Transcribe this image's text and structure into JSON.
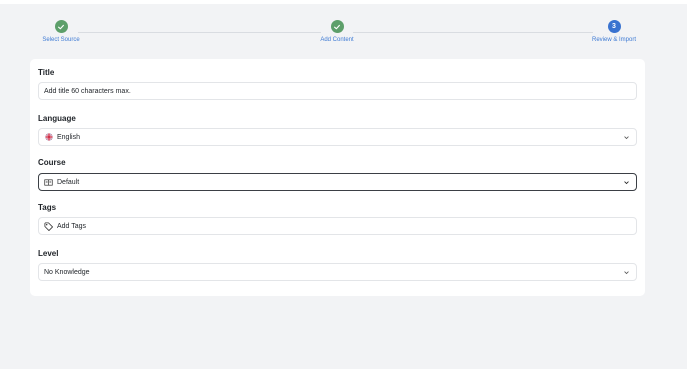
{
  "stepper": {
    "steps": [
      {
        "label": "Select Source",
        "status": "done",
        "number": ""
      },
      {
        "label": "Add Content",
        "status": "done",
        "number": ""
      },
      {
        "label": "Review & Import",
        "status": "active",
        "number": "3"
      }
    ]
  },
  "form": {
    "title": {
      "label": "Title",
      "value": "Add title 60 characters max."
    },
    "language": {
      "label": "Language",
      "value": "English",
      "icon": "uk-flag-icon"
    },
    "course": {
      "label": "Course",
      "value": "Default",
      "icon": "book-icon"
    },
    "tags": {
      "label": "Tags",
      "value": "Add Tags",
      "icon": "tag-icon"
    },
    "level": {
      "label": "Level",
      "value": "No Knowledge"
    }
  },
  "colors": {
    "accent": "#3a73d0",
    "done": "#5d9f6a",
    "background": "#f2f3f5"
  }
}
